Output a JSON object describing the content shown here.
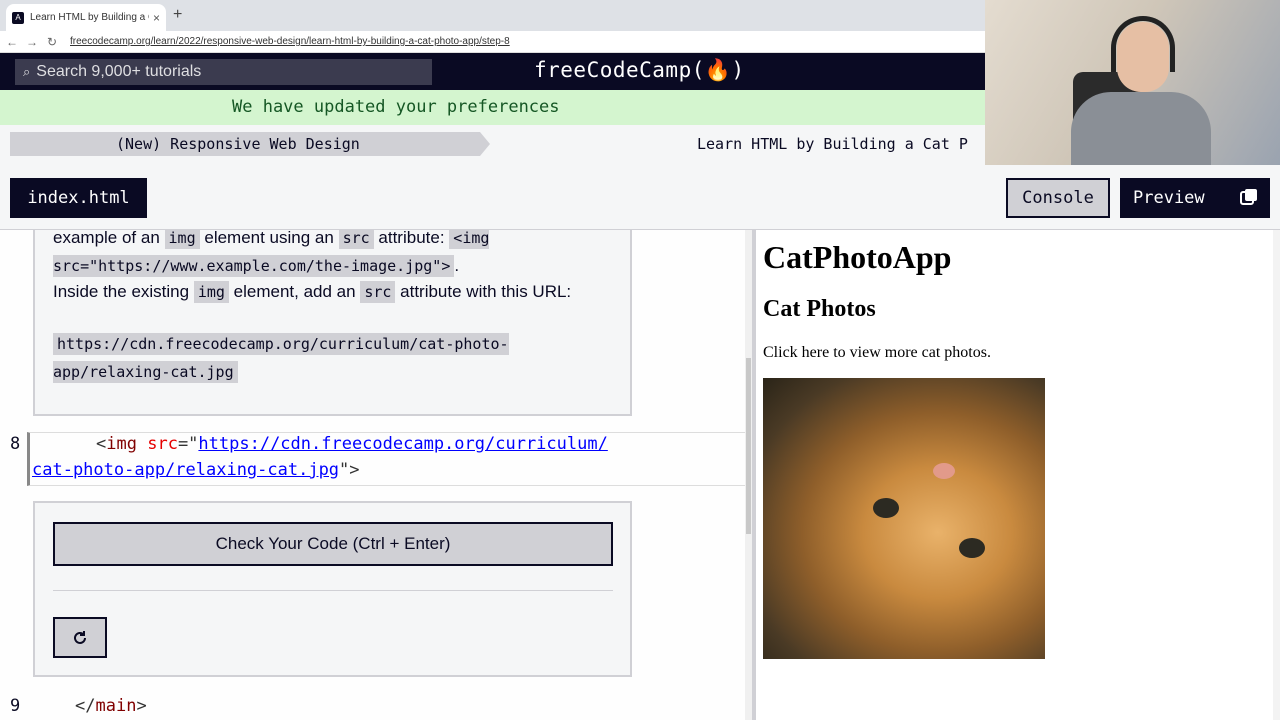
{
  "browser": {
    "tab_title": "Learn HTML by Building a Cat",
    "tab_close": "×",
    "new_tab": "+",
    "nav_back": "←",
    "nav_forward": "→",
    "nav_reload": "↻",
    "url": "freecodecamp.org/learn/2022/responsive-web-design/learn-html-by-building-a-cat-photo-app/step-8"
  },
  "navbar": {
    "search_placeholder": "Search 9,000+ tutorials",
    "logo": "freeCodeCamp(🔥)"
  },
  "flash_message": "We have updated your preferences",
  "breadcrumb": {
    "course": "(New) Responsive Web Design",
    "project": "Learn HTML by Building a Cat P"
  },
  "toolbar": {
    "file_tab": "index.html",
    "console_label": "Console",
    "preview_label": "Preview"
  },
  "description": {
    "p1_prefix": "example of an",
    "p1_code1": "img",
    "p1_mid": "element using an",
    "p1_code2": "src",
    "p1_mid2": "attribute:",
    "p1_code3": "<img src=\"https://www.example.com/the-image.jpg\">",
    "p1_suffix": ".",
    "p2_prefix": "Inside the existing",
    "p2_code1": "img",
    "p2_mid": "element, add an",
    "p2_code2": "src",
    "p2_suffix": "attribute with this URL:",
    "p3_code": "https://cdn.freecodecamp.org/curriculum/cat-photo-app/relaxing-cat.jpg"
  },
  "editor": {
    "line8_number": "8",
    "line8_open": "<",
    "line8_tag": "img",
    "line8_attr": "src",
    "line8_eq": "=\"",
    "line8_url_part1": "https://cdn.freecodecamp.org/curriculum/",
    "line8_url_part2": "cat-photo-app/relaxing-cat.jpg",
    "line8_close": "\">",
    "line9_number": "9",
    "line9_open": "</",
    "line9_tag": "main",
    "line9_close": ">"
  },
  "actions": {
    "check_label": "Check Your Code (Ctrl + Enter)",
    "reset_icon": "reset-icon"
  },
  "preview": {
    "h1": "CatPhotoApp",
    "h2": "Cat Photos",
    "paragraph": "Click here to view more cat photos."
  },
  "colors": {
    "nav_bg": "#0a0a23",
    "flash_bg": "#d4f5cf",
    "panel_bg": "#f5f6f7",
    "code_bg": "#d0d0d5"
  }
}
